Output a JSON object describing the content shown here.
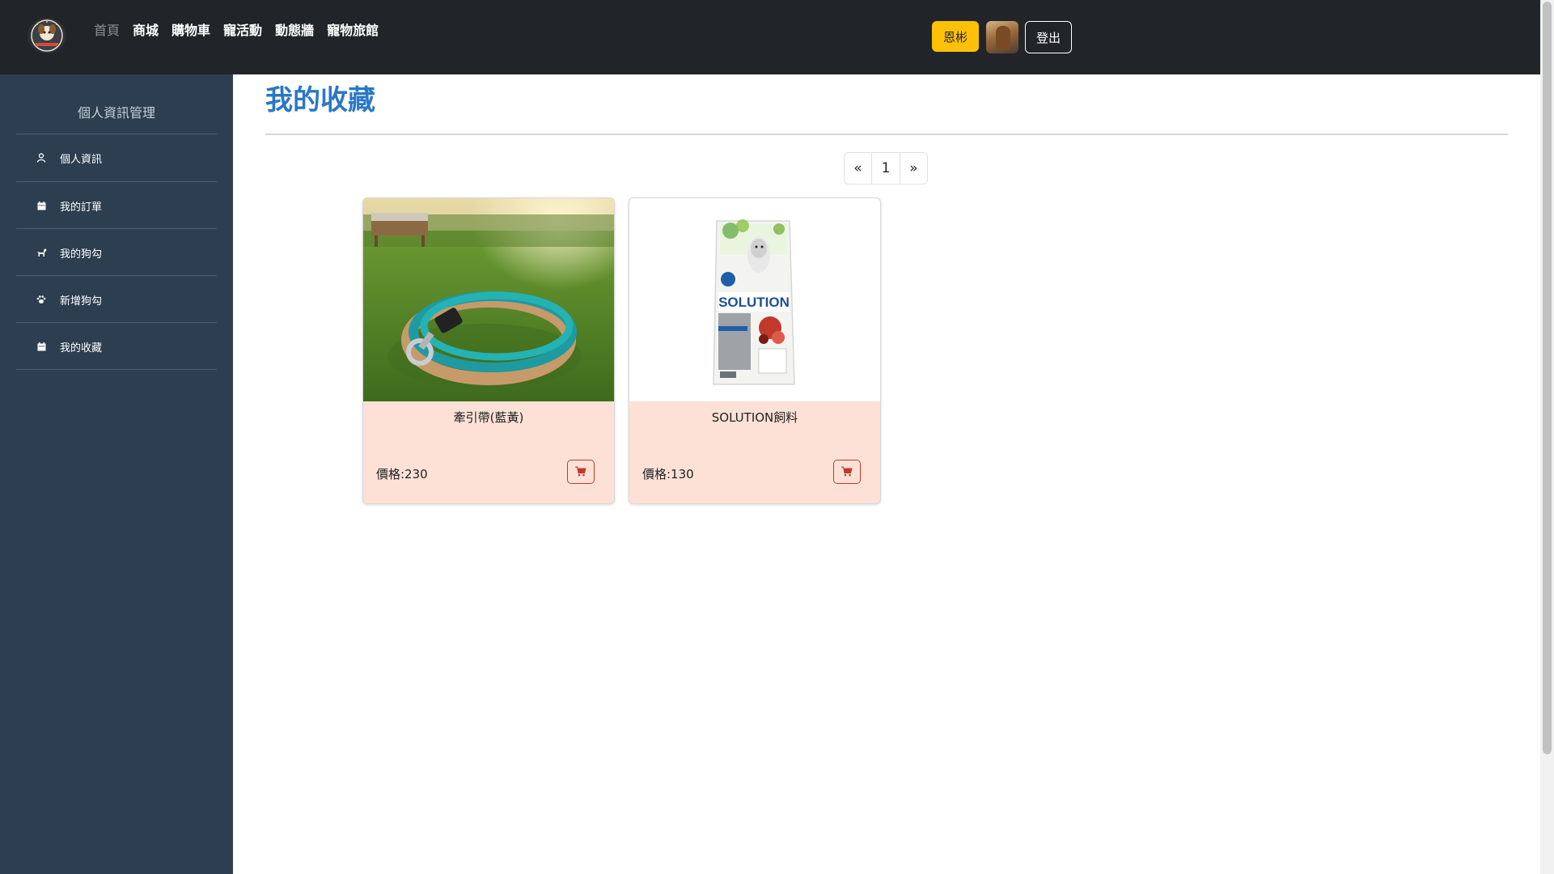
{
  "navbar": {
    "logo_icon": "paw-logo-icon",
    "links": [
      {
        "label": "首頁",
        "active": true
      },
      {
        "label": "商城"
      },
      {
        "label": "購物車"
      },
      {
        "label": "寵活動"
      },
      {
        "label": "動態牆"
      },
      {
        "label": "寵物旅館"
      }
    ],
    "user_name": "恩彬",
    "logout_label": "登出"
  },
  "sidebar": {
    "title": "個人資訊管理",
    "items": [
      {
        "label": "個人資訊",
        "icon": "user-icon"
      },
      {
        "label": "我的訂單",
        "icon": "calendar-icon"
      },
      {
        "label": "我的狗勾",
        "icon": "dog-icon"
      },
      {
        "label": "新增狗勾",
        "icon": "paw-icon"
      },
      {
        "label": "我的收藏",
        "icon": "calendar-icon"
      }
    ]
  },
  "main": {
    "title": "我的收藏",
    "pagination": {
      "prev": "«",
      "current": "1",
      "next": "»"
    },
    "products": [
      {
        "name": "牽引帶(藍黃)",
        "price_label": "價格:230",
        "image": "dog-leash-on-grass"
      },
      {
        "name": "SOLUTION飼料",
        "price_label": "價格:130",
        "image": "solution-dog-food-bag"
      }
    ]
  },
  "colors": {
    "navbar_bg": "#212529",
    "sidebar_bg": "#2c3e50",
    "title_blue": "#2a78c5",
    "user_button": "#ffc107",
    "card_bg": "#fde1d6",
    "cart_red": "#c0392b"
  }
}
